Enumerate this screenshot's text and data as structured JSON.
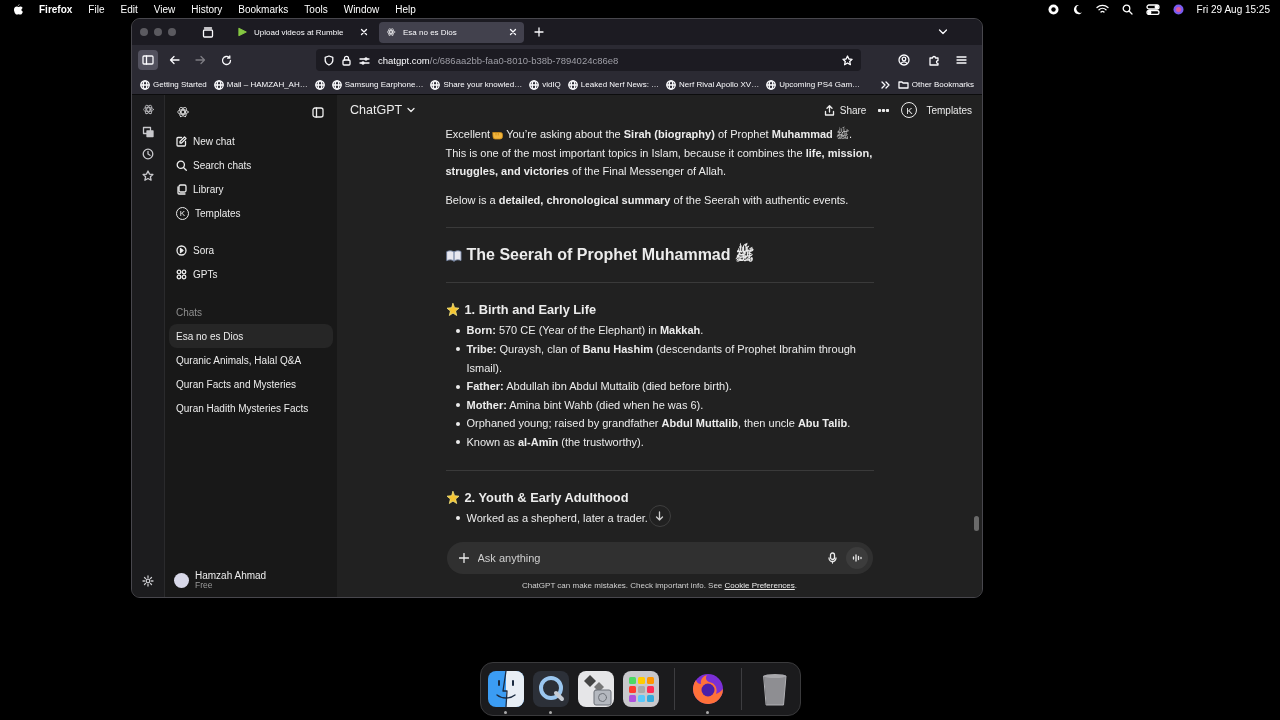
{
  "menubar": {
    "app": "Firefox",
    "menus": [
      "File",
      "Edit",
      "View",
      "History",
      "Bookmarks",
      "Tools",
      "Window",
      "Help"
    ],
    "clock": "Fri 29 Aug  15:25"
  },
  "browser": {
    "tabs": [
      {
        "title": "Upload videos at Rumble",
        "kind": "rumble",
        "selected": false
      },
      {
        "title": "Esa no es Dios",
        "kind": "chatgpt",
        "selected": true
      }
    ],
    "nav_buttons": [
      {
        "kind": "back",
        "disabled": false
      },
      {
        "kind": "forward",
        "disabled": true
      },
      {
        "kind": "reload",
        "disabled": false
      }
    ],
    "url": {
      "host": "chatgpt.com",
      "path": "/c/686aa2bb-faa0-8010-b38b-7894024c86e8"
    },
    "bookmarks": [
      {
        "kind": "link",
        "title": "Getting Started"
      },
      {
        "kind": "link",
        "title": "Mail – HAMZAH_AH…"
      },
      {
        "kind": "icon"
      },
      {
        "kind": "link",
        "title": "Samsung Earphone…"
      },
      {
        "kind": "link",
        "title": "Share your knowled…"
      },
      {
        "kind": "link",
        "title": "vidIQ"
      },
      {
        "kind": "link",
        "title": "Leaked Nerf News: …"
      },
      {
        "kind": "link",
        "title": "Nerf Rival Apollo XV…"
      },
      {
        "kind": "link",
        "title": "Upcoming PS4 Gam…"
      }
    ],
    "other_bookmarks": "Other Bookmarks"
  },
  "sidebar": {
    "nav": [
      {
        "kind": "new",
        "label": "New chat"
      },
      {
        "kind": "search",
        "label": "Search chats"
      },
      {
        "kind": "library",
        "label": "Library"
      },
      {
        "kind": "templates",
        "label": "Templates",
        "badge": "K"
      },
      {
        "kind": "sora",
        "label": "Sora"
      },
      {
        "kind": "gpts",
        "label": "GPTs"
      }
    ],
    "section": "Chats",
    "chats": [
      {
        "title": "Esa no es Dios",
        "selected": true
      },
      {
        "title": "Quranic Animals, Halal Q&A",
        "selected": false
      },
      {
        "title": "Quran Facts and Mysteries",
        "selected": false
      },
      {
        "title": "Quran Hadith Mysteries Facts",
        "selected": false
      }
    ],
    "user": {
      "name": "Hamzah Ahmad",
      "plan": "Free"
    }
  },
  "header": {
    "model": "ChatGPT",
    "share": "Share",
    "templates": "Templates",
    "templates_badge": "K"
  },
  "message": [
    {
      "kind": "lead",
      "before": "Excellent",
      "after": [
        "You’re asking about the **Sirah (biography)** of Prophet **Muhammad** ﷺ.",
        "This is one of the most important topics in Islam, because it combines the **life, mission, struggles, and victories** of the Final Messenger of Allah."
      ]
    },
    {
      "kind": "text",
      "text": "Below is a **detailed, chronological summary** of the Seerah with authentic events."
    },
    {
      "kind": "rule"
    },
    {
      "kind": "title",
      "text": "The Seerah of Prophet Muhammad ﷺ"
    },
    {
      "kind": "rule"
    },
    {
      "kind": "heading",
      "text": "1. Birth and Early Life"
    },
    {
      "kind": "list",
      "items": [
        "**Born:** 570 CE (Year of the Elephant) in **Makkah**.",
        "**Tribe:** Quraysh, clan of **Banu Hashim** (descendants of Prophet Ibrahim through Ismail).",
        "**Father:** Abdullah ibn Abdul Muttalib (died before birth).",
        "**Mother:** Amina bint Wahb (died when he was 6).",
        "Orphaned young; raised by grandfather **Abdul Muttalib**, then uncle **Abu Talib**.",
        "Known as **al-Amīn** (the trustworthy)."
      ]
    },
    {
      "kind": "rule"
    },
    {
      "kind": "heading",
      "text": "2. Youth & Early Adulthood"
    },
    {
      "kind": "list",
      "items": [
        "Worked as a shepherd, later a trader."
      ]
    }
  ],
  "composer": {
    "placeholder": "Ask anything"
  },
  "footer": {
    "text": "ChatGPT can make mistakes. Check important info. See",
    "link": "Cookie Preferences",
    "end": "."
  },
  "dock": [
    {
      "kind": "finder",
      "running": true
    },
    {
      "kind": "quicktime",
      "running": true
    },
    {
      "kind": "bootcamp",
      "running": false
    },
    {
      "kind": "launchpad",
      "running": false
    },
    {
      "kind": "separator"
    },
    {
      "kind": "firefox",
      "running": true
    },
    {
      "kind": "separator"
    },
    {
      "kind": "trash",
      "running": false
    }
  ]
}
